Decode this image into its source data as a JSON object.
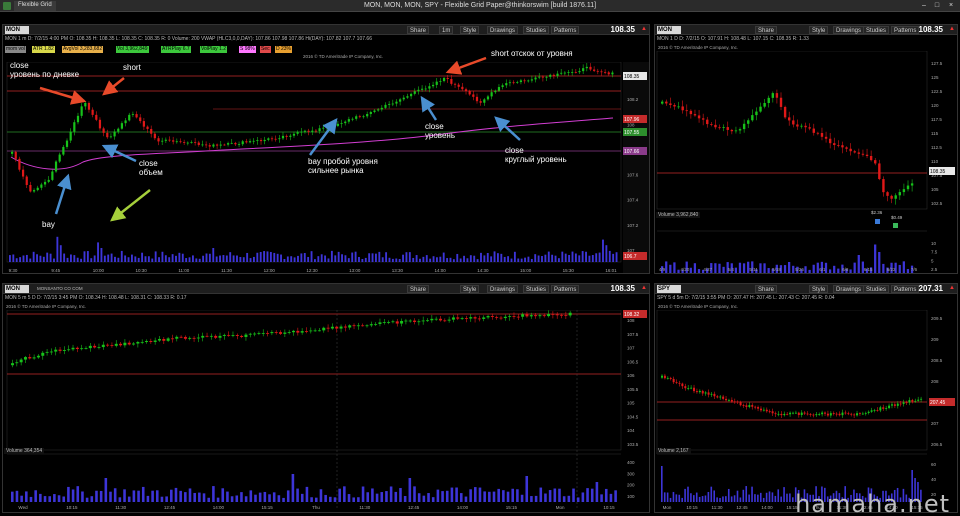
{
  "window": {
    "title": "MON, MON, MON, SPY - Flexible Grid Paper@thinkorswim [build 1876.11]",
    "tab": "Flexible Grid"
  },
  "buttons": {
    "share": "Share",
    "style": "Style",
    "drawings": "Drawings",
    "studies": "Studies",
    "patterns": "Patterns"
  },
  "panels": {
    "main": {
      "symbol": "MON",
      "price": "108.35",
      "ohlc": "MON 1 m   D: 7/2/15 4:00 PM   O: 108.35   H: 108.35   L: 108.35   C: 108.35   R: 0   Volume: 200   VWAP (HLC3,0,0,DAY): 107.86  107.98  107.86  Hi(DAY): 107.82  107.7  107.66",
      "studies": [
        "mom vol",
        "ATR 1.82",
        "AvgVol 3,283,682",
        "Vol 3,962,849",
        "ATRPlay 6.7",
        "VolPlay 1.2",
        "S 98%",
        "Sec",
        "D 23%"
      ],
      "copyright": "2016 © TD Ameritrade IP Company, Inc.",
      "price_axis": [
        "108.5",
        "108.2",
        "108",
        "107.8",
        "107.6",
        "107.4",
        "107.2",
        "107"
      ],
      "price_tags": [
        "108.35",
        "107.96",
        "107.55",
        "107.66",
        "106.7"
      ],
      "time_axis": [
        "9:30",
        "9:45",
        "10:00",
        "10:30",
        "11:00",
        "11:30",
        "12:00",
        "12:30",
        "13:00",
        "13:30",
        "14:00",
        "14:30",
        "15:00",
        "15:30",
        "16:01"
      ]
    },
    "daily": {
      "symbol": "MON",
      "price": "108.35",
      "ohlc": "MON 1 D   D: 7/2/15   O: 107.91   H: 108.48   L: 107.15   C: 108.35   R: 1.33",
      "copyright": "2016 © TD Ameritrade IP Company, Inc.",
      "price_axis": [
        "127.5",
        "125",
        "122.5",
        "120",
        "117.5",
        "115",
        "112.5",
        "110",
        "107.5",
        "105",
        "102.5"
      ],
      "price_tag": "108.35",
      "volume_label": "Volume  3,962,840",
      "volume_axis": [
        "10",
        "7.5",
        "5",
        "2.5"
      ],
      "time_axis": [
        "4/9",
        "4/20",
        "4/27",
        "5/4",
        "5/11",
        "5/18",
        "5/26",
        "6/1",
        "6/8",
        "6/15",
        "6/22",
        "7/6"
      ],
      "event_labels": [
        "$2.36",
        "$0.49"
      ]
    },
    "five_min": {
      "symbol": "MON",
      "price": "108.35",
      "ohlc": "MON 5 m 5 D   D: 7/2/15 3:45 PM   O: 108.34   H: 108.48   L: 108.31   C: 108.33   R: 0.17",
      "header_note": "MONSANTO CO COM",
      "copyright": "2016 © TD Ameritrade IP Company, Inc.",
      "price_axis": [
        "108",
        "107.5",
        "107",
        "106.5",
        "106",
        "105.5",
        "105",
        "104.5",
        "104",
        "103.5"
      ],
      "price_tag": "108.32",
      "volume_label": "Volume  364,354",
      "volume_axis": [
        "400",
        "300",
        "200",
        "100"
      ],
      "time_axis": [
        "Wed",
        "10:15",
        "11:30",
        "12:45",
        "14:00",
        "15:15",
        "Thu",
        "11:30",
        "12:45",
        "14:00",
        "15:15",
        "Mon",
        "10:15"
      ]
    },
    "spy": {
      "symbol": "SPY",
      "price": "207.31",
      "ohlc": "SPY 5 d 5m   D: 7/2/15 3:55 PM   O: 207.47   H: 207.45   L: 207.43   C: 207.45   R: 0.04",
      "copyright": "2016 © TD Ameritrade IP Company, Inc.",
      "price_axis": [
        "209.5",
        "209",
        "208.5",
        "208",
        "207.5",
        "207",
        "206.5"
      ],
      "price_tag": "207.45",
      "volume_label": "Volume  2,167",
      "volume_axis": [
        "60",
        "40",
        "20"
      ],
      "time_axis": [
        "Mon",
        "10:15",
        "11:30",
        "12:45",
        "14:00",
        "15:15",
        "Thu",
        "11:30",
        "12:45",
        "14:00",
        "15:15"
      ]
    }
  },
  "annotations": {
    "close_daily": [
      "close",
      "уровень по дневке"
    ],
    "short1": "short",
    "short2": "short  отскок от уровня",
    "close_volume": [
      "close",
      "объем"
    ],
    "buy1": "bay",
    "buy2": [
      "bay  пробой уровня",
      "сильнее рынка"
    ],
    "close_level": [
      "close",
      "уровень"
    ],
    "close_round": [
      "close",
      "круглый уровень"
    ]
  },
  "watermark": "hamaha.net",
  "colors": {
    "up": "#17c21a",
    "down": "#e01818",
    "vwap": "#d23ed2",
    "level_red": "#c42b2b",
    "level_green": "#2d8f2d",
    "volume": "#3d35d8",
    "arrow_red": "#e84a2a",
    "arrow_blue": "#4a8fd0",
    "arrow_green": "#a5cf3b"
  },
  "chart_data": [
    {
      "type": "candlestick",
      "symbol": "MON",
      "title": "MON 1 m",
      "x": [
        "9:30",
        "16:01"
      ],
      "ylim": [
        106.8,
        108.6
      ],
      "series": [
        {
          "name": "VWAP",
          "values": [
            107.4,
            107.55,
            107.7,
            107.72,
            107.74,
            107.77,
            107.8,
            107.85,
            107.9,
            107.93,
            107.96
          ]
        }
      ],
      "levels": [
        108.35,
        108.2,
        107.96,
        107.55,
        107.66,
        106.7
      ]
    }
  ]
}
